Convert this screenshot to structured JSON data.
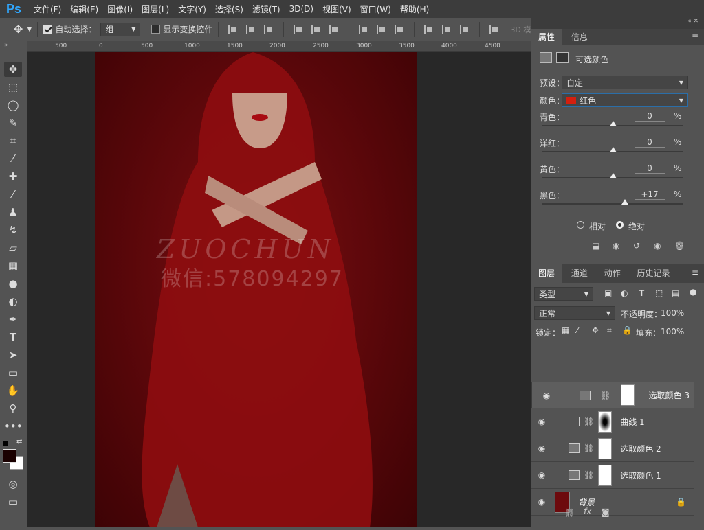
{
  "menubar": {
    "logo": "Ps",
    "items": [
      "文件(F)",
      "编辑(E)",
      "图像(I)",
      "图层(L)",
      "文字(Y)",
      "选择(S)",
      "滤镜(T)",
      "3D(D)",
      "视图(V)",
      "窗口(W)",
      "帮助(H)"
    ]
  },
  "options": {
    "auto_select_label": "自动选择：",
    "auto_select_value": "组",
    "show_transform_label": "显示变换控件",
    "mode_3d": "3D 模"
  },
  "ruler": {
    "ticks": [
      "500",
      "0",
      "500",
      "1000",
      "1500",
      "2000",
      "2500",
      "3000",
      "3500",
      "4000",
      "4500"
    ]
  },
  "watermark": {
    "line1": "ZUOCHUN",
    "line2": "微信:578094297"
  },
  "properties": {
    "tabs": [
      "属性",
      "信息"
    ],
    "title": "可选颜色",
    "preset_label": "预设：",
    "preset_value": "自定",
    "color_label": "颜色：",
    "color_value": "红色",
    "color_swatch": "#d41f0f",
    "sliders": [
      {
        "label": "青色：",
        "value": "0",
        "pos": 0.5
      },
      {
        "label": "洋红：",
        "value": "0",
        "pos": 0.5
      },
      {
        "label": "黄色：",
        "value": "0",
        "pos": 0.5
      },
      {
        "label": "黑色：",
        "value": "+17",
        "pos": 0.585
      }
    ],
    "pct": "%",
    "method_relative": "相对",
    "method_absolute": "绝对"
  },
  "layers": {
    "tabs": [
      "图层",
      "通道",
      "动作",
      "历史记录"
    ],
    "filter_label": "类型",
    "blend_mode": "正常",
    "opacity_label": "不透明度：",
    "opacity_value": "100%",
    "lock_label": "锁定：",
    "fill_label": "填充：",
    "fill_value": "100%",
    "items": [
      {
        "name": "选取颜色 3",
        "selected": true
      },
      {
        "name": "曲线 1",
        "selected": false
      },
      {
        "name": "选取颜色 2",
        "selected": false
      },
      {
        "name": "选取颜色 1",
        "selected": false
      },
      {
        "name": "背景",
        "selected": false
      }
    ],
    "footer_fx": "fx"
  }
}
